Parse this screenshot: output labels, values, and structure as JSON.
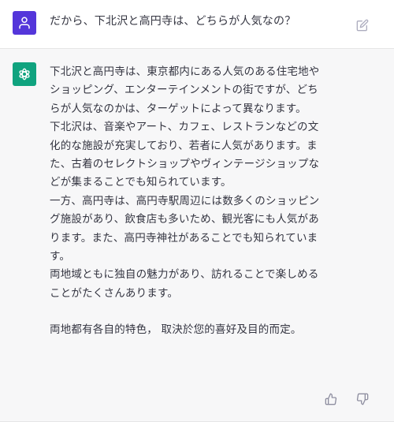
{
  "user_message": {
    "text": "だから、下北沢と高円寺は、どちらが人気なの？",
    "avatar_icon": "user-icon",
    "edit_icon": "edit-icon",
    "avatar_color": "#5436da"
  },
  "assistant_message": {
    "avatar_icon": "openai-logo-icon",
    "avatar_color": "#10a37f",
    "paragraphs": [
      "下北沢と高円寺は、東京都内にある人気のある住宅地やショッピング、エンターテインメントの街ですが、どちらが人気なのかは、ターゲットによって異なります。",
      "下北沢は、音楽やアート、カフェ、レストランなどの文化的な施設が充実しており、若者に人気があります。また、古着のセレクトショップやヴィンテージショップなどが集まることでも知られています。",
      "一方、高円寺は、高円寺駅周辺には数多くのショッピング施設があり、飲食店も多いため、観光客にも人気があります。また、高円寺神社があることでも知られています。",
      "両地域ともに独自の魅力があり、訪れることで楽しめることがたくさんあります。"
    ],
    "summary": "両地都有各自的特色， 取決於您的喜好及目的而定。",
    "feedback_icons": [
      "thumbs-up-icon",
      "thumbs-down-icon"
    ]
  }
}
